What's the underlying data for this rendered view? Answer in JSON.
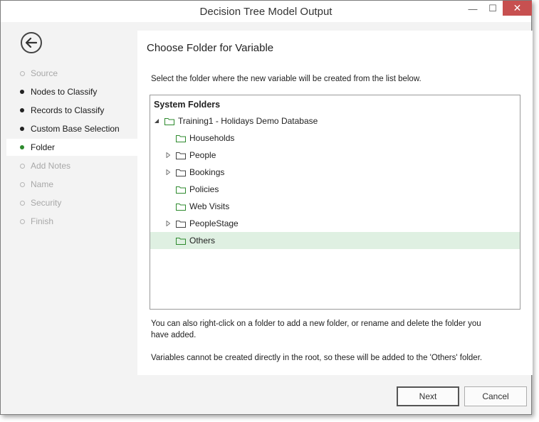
{
  "window": {
    "title": "Decision Tree Model Output",
    "minimize_glyph": "—",
    "maximize_glyph": "☐",
    "close_glyph": "✕"
  },
  "sidebar": {
    "items": [
      {
        "label": "Source",
        "state": "disabled"
      },
      {
        "label": "Nodes to Classify",
        "state": "done"
      },
      {
        "label": "Records to Classify",
        "state": "done"
      },
      {
        "label": "Custom Base Selection",
        "state": "done"
      },
      {
        "label": "Folder",
        "state": "current"
      },
      {
        "label": "Add Notes",
        "state": "pending"
      },
      {
        "label": "Name",
        "state": "pending"
      },
      {
        "label": "Security",
        "state": "pending"
      },
      {
        "label": "Finish",
        "state": "pending"
      }
    ]
  },
  "main": {
    "heading": "Choose Folder for Variable",
    "intro": "Select the folder where the new variable will be created from the list below.",
    "tree": {
      "header": "System Folders",
      "rows": [
        {
          "label": "Training1 - Holidays Demo Database",
          "level": 0,
          "expander": "expanded"
        },
        {
          "label": "Households",
          "level": 1,
          "expander": "none"
        },
        {
          "label": "People",
          "level": 1,
          "expander": "collapsed"
        },
        {
          "label": "Bookings",
          "level": 1,
          "expander": "collapsed"
        },
        {
          "label": "Policies",
          "level": 1,
          "expander": "none"
        },
        {
          "label": "Web Visits",
          "level": 1,
          "expander": "none"
        },
        {
          "label": "PeopleStage",
          "level": 1,
          "expander": "collapsed"
        },
        {
          "label": "Others",
          "level": 1,
          "expander": "none",
          "selected": true
        }
      ]
    },
    "note1_line1": "You can also right-click on a folder to add a new folder, or rename and delete the folder you",
    "note1_line2": "have added.",
    "note2": "Variables cannot be created directly in the root, so these will be added to the 'Others' folder."
  },
  "footer": {
    "next_label": "Next",
    "cancel_label": "Cancel"
  },
  "colors": {
    "close_button": "#c75050",
    "selected_row": "#dff0e2",
    "folder_icon": "#2d8a2d",
    "current_step_dot": "#2d8a2d"
  }
}
